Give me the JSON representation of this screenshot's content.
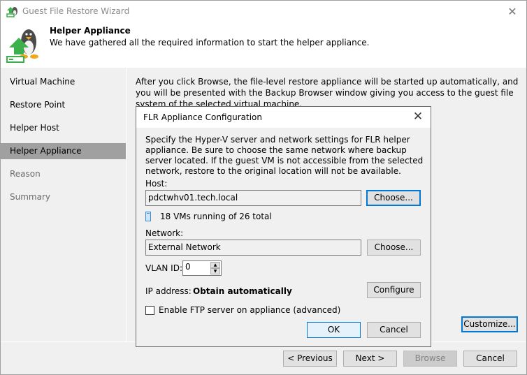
{
  "window": {
    "title": "Guest File Restore Wizard",
    "close_icon": "close-icon"
  },
  "header": {
    "title": "Helper Appliance",
    "subtitle": "We have gathered all the required information to start the helper appliance.",
    "icon": "linux-penguin-upload-icon"
  },
  "sidebar": {
    "items": [
      {
        "label": "Virtual Machine",
        "state": "normal"
      },
      {
        "label": "Restore Point",
        "state": "normal"
      },
      {
        "label": "Helper Host",
        "state": "normal"
      },
      {
        "label": "Helper Appliance",
        "state": "active"
      },
      {
        "label": "Reason",
        "state": "disabled"
      },
      {
        "label": "Summary",
        "state": "disabled"
      }
    ]
  },
  "main": {
    "description": "After you click Browse, the file-level restore appliance will be started up automatically, and you will be presented with the Backup Browser window giving you access to the guest file system of the selected virtual machine.",
    "customize_label": "Customize..."
  },
  "dialog": {
    "title": "FLR Appliance Configuration",
    "description": "Specify the Hyper-V server and network settings for FLR helper appliance. Be sure to choose the same network where backup server located. If the guest VM is not accessible from the selected network, restore to the original location will not be available.",
    "host_label": "Host:",
    "host_value": "pdctwhv01.tech.local",
    "host_choose_label": "Choose...",
    "vm_status": "18 VMs running of 26 total",
    "network_label": "Network:",
    "network_value": "External Network",
    "network_choose_label": "Choose...",
    "vlan_label": "VLAN ID:",
    "vlan_value": "0",
    "ip_label": "IP address:",
    "ip_value": "Obtain automatically",
    "configure_label": "Configure",
    "ftp_label": "Enable FTP server on appliance (advanced)",
    "ftp_checked": false,
    "ok_label": "OK",
    "cancel_label": "Cancel"
  },
  "footer": {
    "previous_label": "< Previous",
    "next_label": "Next >",
    "browse_label": "Browse",
    "cancel_label": "Cancel"
  },
  "colors": {
    "accent": "#0078d7",
    "active_step_bg": "#a0a0a0",
    "icon_green": "#3cb04a"
  }
}
